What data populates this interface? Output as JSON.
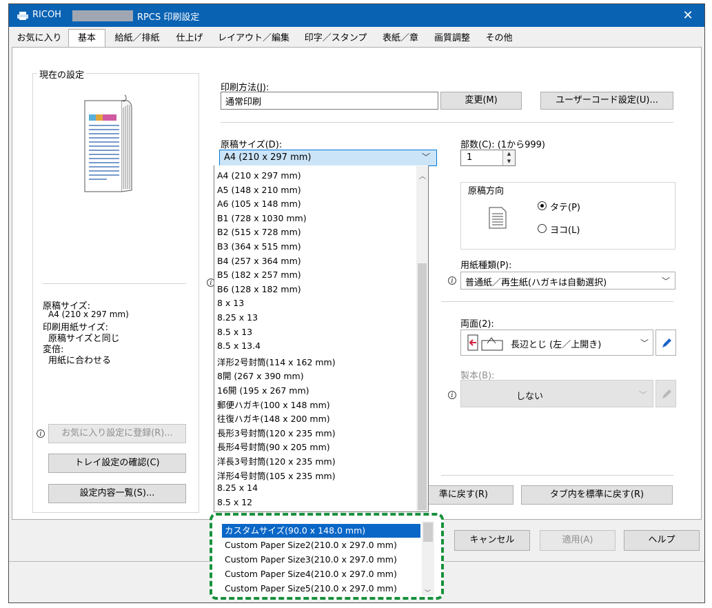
{
  "window": {
    "title_prefix": "RICOH",
    "title_suffix": "RPCS 印刷設定",
    "close": "✕"
  },
  "tabs": [
    {
      "label": "お気に入り",
      "active": false
    },
    {
      "label": "基本",
      "active": true
    },
    {
      "label": "給紙／排紙",
      "active": false
    },
    {
      "label": "仕上げ",
      "active": false
    },
    {
      "label": "レイアウト／編集",
      "active": false
    },
    {
      "label": "印字／スタンプ",
      "active": false
    },
    {
      "label": "表紙／章",
      "active": false
    },
    {
      "label": "画質調整",
      "active": false
    },
    {
      "label": "その他",
      "active": false
    }
  ],
  "current_settings": {
    "group_title": "現在の設定",
    "summary": [
      {
        "text": "原稿サイズ:",
        "indent": false
      },
      {
        "text": "A4 (210 x 297 mm)",
        "indent": true
      },
      {
        "text": "印刷用紙サイズ:",
        "indent": false
      },
      {
        "text": "原稿サイズと同じ",
        "indent": true
      },
      {
        "text": "変倍:",
        "indent": false
      },
      {
        "text": "用紙に合わせる",
        "indent": true
      }
    ],
    "register_button": "お気に入り設定に登録(R)...",
    "tray_button": "トレイ設定の確認(C)",
    "list_button": "設定内容一覧(S)..."
  },
  "print_method": {
    "label": "印刷方法(J):",
    "value": "通常印刷",
    "change_button": "変更(M)",
    "usercode_button": "ユーザーコード設定(U)..."
  },
  "paper_size": {
    "label": "原稿サイズ(D):",
    "selected": "A4 (210 x 297 mm)",
    "options": [
      "A4 (210 x 297 mm)",
      "A5 (148 x 210 mm)",
      "A6 (105 x 148 mm)",
      "B1 (728 x 1030 mm)",
      "B2 (515 x 728 mm)",
      "B3 (364 x 515 mm)",
      "B4 (257 x 364 mm)",
      "B5 (182 x 257 mm)",
      "B6 (128 x 182 mm)",
      "8 x 13",
      "8.25 x 13",
      "8.5 x 13",
      "8.5 x 13.4",
      "洋形2号封筒(114 x 162 mm)",
      "8開 (267 x 390 mm)",
      "16開 (195 x 267 mm)",
      "郵便ハガキ(100 x 148 mm)",
      "往復ハガキ(148 x 200 mm)",
      "長形3号封筒(120 x 235 mm)",
      "長形4号封筒(90 x 205 mm)",
      "洋長3号封筒(120 x 235 mm)",
      "洋形4号封筒(105 x 235 mm)",
      "8.25 x 14",
      "8.5 x 12"
    ],
    "custom_options": [
      "カスタムサイズ(90.0 x 148.0 mm)",
      "Custom Paper Size2(210.0 x 297.0 mm)",
      "Custom Paper Size3(210.0 x 297.0 mm)",
      "Custom Paper Size4(210.0 x 297.0 mm)",
      "Custom Paper Size5(210.0 x 297.0 mm)"
    ],
    "custom_highlight_color": "#17913c"
  },
  "copies": {
    "label": "部数(C): (1から999)",
    "value": "1"
  },
  "orientation": {
    "group_title": "原稿方向",
    "portrait": "タテ(P)",
    "landscape": "ヨコ(L)",
    "selected": "portrait"
  },
  "paper_type": {
    "label": "用紙種類(P):",
    "value": "普通紙／再生紙(ハガキは自動選択)"
  },
  "duplex": {
    "label": "両面(2):",
    "value": "長辺とじ (左／上開き)"
  },
  "booklet": {
    "label": "製本(B):",
    "value": "しない"
  },
  "reset": {
    "reset_partial": "準に戻す(R)",
    "reset_tab": "タブ内を標準に戻す(R)"
  },
  "footer": {
    "cancel": "キャンセル",
    "apply": "適用(A)",
    "help": "ヘルプ"
  },
  "colors": {
    "titlebar": "#0a62b3",
    "selection": "#0a67c7",
    "combo_selected_bg": "#cce4f7"
  }
}
